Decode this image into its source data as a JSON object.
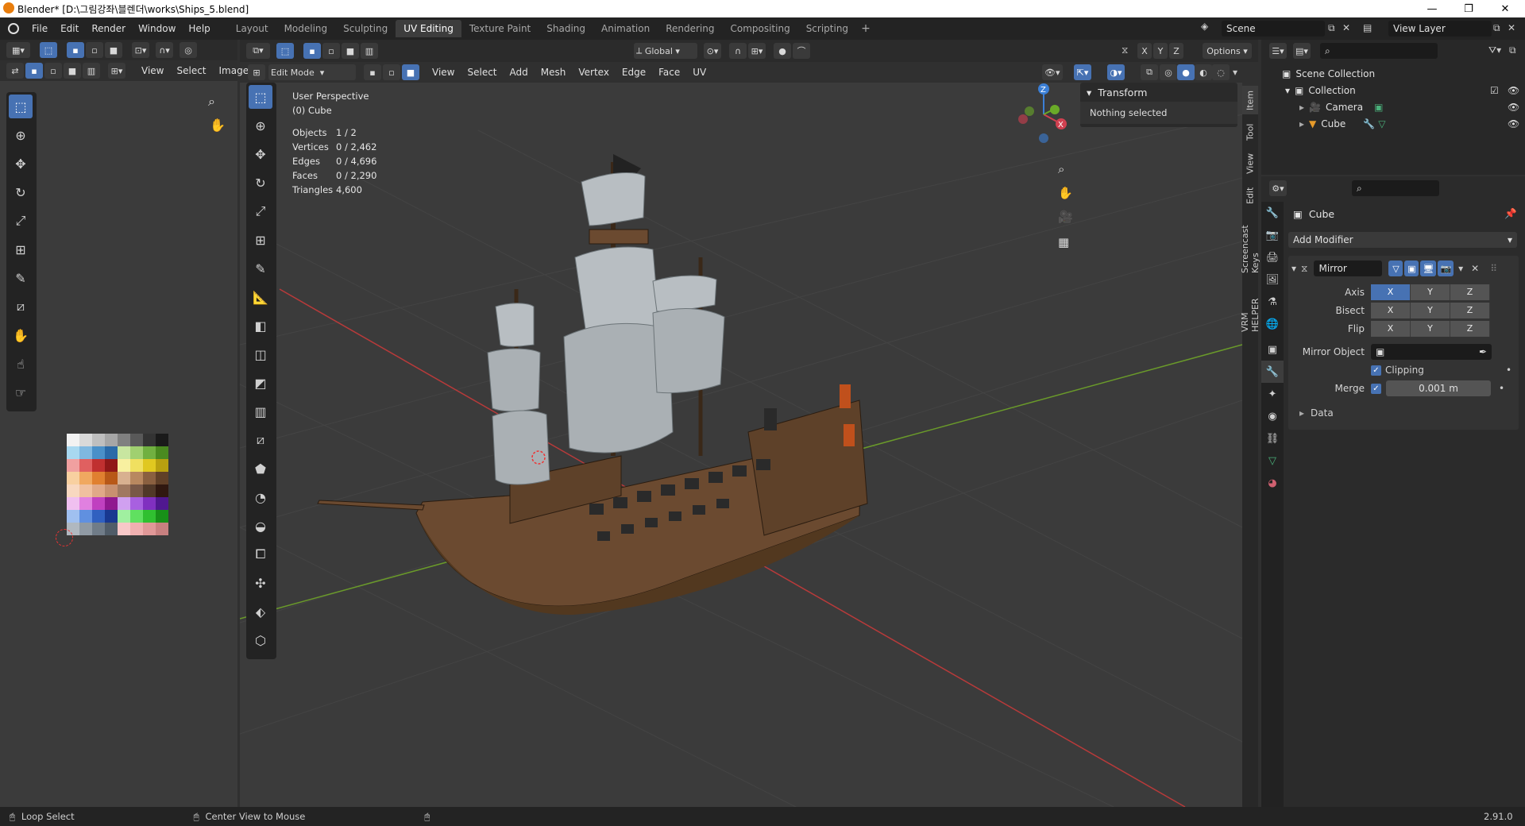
{
  "window": {
    "title": "Blender* [D:\\그림강좌\\블렌더\\works\\Ships_5.blend]",
    "minimize": "—",
    "maximize": "❐",
    "close": "✕"
  },
  "menubar": [
    "File",
    "Edit",
    "Render",
    "Window",
    "Help"
  ],
  "workspaces": [
    "Layout",
    "Modeling",
    "Sculpting",
    "UV Editing",
    "Texture Paint",
    "Shading",
    "Animation",
    "Rendering",
    "Compositing",
    "Scripting"
  ],
  "active_workspace": "UV Editing",
  "scene": {
    "name": "Scene",
    "view_layer": "View Layer"
  },
  "uv_editor": {
    "menus": [
      "View",
      "Select",
      "Image"
    ]
  },
  "viewport": {
    "mode": "Edit Mode",
    "menus": [
      "View",
      "Select",
      "Add",
      "Mesh",
      "Vertex",
      "Edge",
      "Face",
      "UV"
    ],
    "orientation": "Global",
    "options_label": "Options",
    "axes": [
      "X",
      "Y",
      "Z"
    ],
    "perspective": "User Perspective",
    "object_name": "(0) Cube",
    "stats": [
      {
        "k": "Objects",
        "v": "1 / 2"
      },
      {
        "k": "Vertices",
        "v": "0 / 2,462"
      },
      {
        "k": "Edges",
        "v": "0 / 4,696"
      },
      {
        "k": "Faces",
        "v": "0 / 2,290"
      },
      {
        "k": "Triangles",
        "v": "4,600"
      }
    ]
  },
  "npanel": {
    "header": "Transform",
    "message": "Nothing selected"
  },
  "side_tabs": [
    "Item",
    "Tool",
    "View",
    "Edit",
    "Screencast Keys",
    "VRM HELPER"
  ],
  "outliner": {
    "root": "Scene Collection",
    "collection": "Collection",
    "items": [
      "Camera",
      "Cube"
    ]
  },
  "properties": {
    "object": "Cube",
    "add_modifier": "Add Modifier",
    "modifier_name": "Mirror",
    "rows": [
      {
        "label": "Axis",
        "vals": [
          "X",
          "Y",
          "Z"
        ],
        "on": [
          true,
          false,
          false
        ]
      },
      {
        "label": "Bisect",
        "vals": [
          "X",
          "Y",
          "Z"
        ],
        "on": [
          false,
          false,
          false
        ]
      },
      {
        "label": "Flip",
        "vals": [
          "X",
          "Y",
          "Z"
        ],
        "on": [
          false,
          false,
          false
        ]
      }
    ],
    "mirror_object_label": "Mirror Object",
    "clipping_label": "Clipping",
    "merge_label": "Merge",
    "merge_value": "0.001 m",
    "data_label": "Data"
  },
  "status": {
    "left": "Loop Select",
    "middle": "Center View to Mouse",
    "version": "2.91.0"
  },
  "palette": [
    [
      "#f2f2f2",
      "#d9d9d9",
      "#bfbfbf",
      "#a6a6a6",
      "#808080",
      "#595959",
      "#333333",
      "#1a1a1a"
    ],
    [
      "#a8d8f0",
      "#7fb8e0",
      "#4a90c8",
      "#2a6aa8",
      "#c8e6a0",
      "#a0d070",
      "#70b040",
      "#4a8a20"
    ],
    [
      "#f0a0a0",
      "#e06060",
      "#c03030",
      "#901818",
      "#f8f0a0",
      "#f0e060",
      "#e0c820",
      "#b8a010"
    ],
    [
      "#f8d0a0",
      "#f0a860",
      "#e08030",
      "#b85818",
      "#d8b090",
      "#b88860",
      "#8a6040",
      "#604028"
    ],
    [
      "#f8d8c0",
      "#f0c0a0",
      "#e0a888",
      "#c89070",
      "#a07860",
      "#785848",
      "#503828",
      "#301810"
    ],
    [
      "#f0c0f0",
      "#e080e0",
      "#c040c0",
      "#901890",
      "#d0a0f0",
      "#a860e0",
      "#8030c0",
      "#501890"
    ],
    [
      "#a0c0f0",
      "#6090e0",
      "#3060c0",
      "#183890",
      "#a0f0a0",
      "#60e060",
      "#30c030",
      "#189018"
    ],
    [
      "#b0b8c0",
      "#909aa4",
      "#707c88",
      "#505c68",
      "#f8c8c8",
      "#f0b0b0",
      "#e09898",
      "#c88080"
    ]
  ],
  "colors": {
    "accent": "#4772b3",
    "grid_x": "#b83a3a",
    "grid_y": "#6a9a2a",
    "hull": "#6b4a30",
    "sail": "#b8bec2"
  }
}
